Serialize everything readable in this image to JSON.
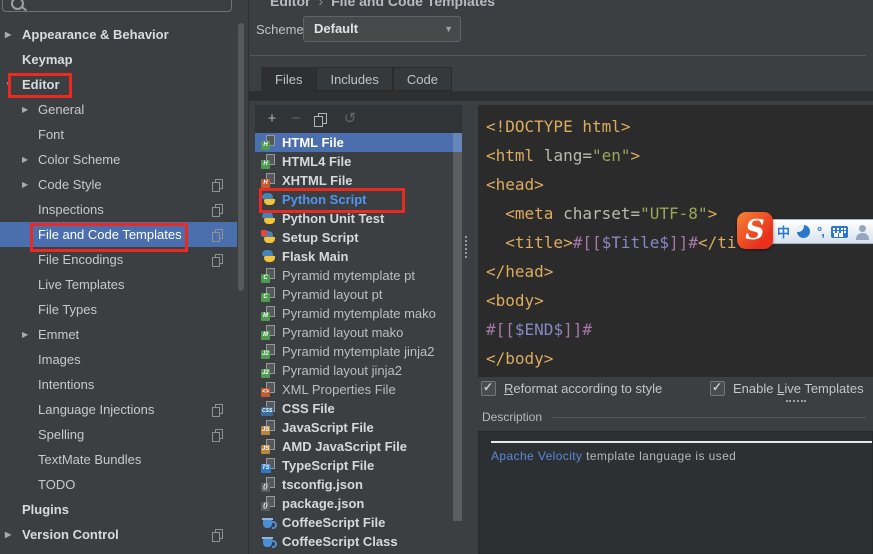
{
  "breadcrumb": {
    "section": "Editor",
    "separator": "›",
    "page": "File and Code Templates"
  },
  "search": {
    "placeholder": ""
  },
  "sidebar": {
    "items": [
      {
        "label": "Appearance & Behavior",
        "level": 1,
        "bold": true,
        "chevron": "right"
      },
      {
        "label": "Keymap",
        "level": 1,
        "bold": true
      },
      {
        "label": "Editor",
        "level": 1,
        "bold": true,
        "chevron": "down",
        "annotated": true
      },
      {
        "label": "General",
        "level": 2,
        "chevron": "right"
      },
      {
        "label": "Font",
        "level": 2
      },
      {
        "label": "Color Scheme",
        "level": 2,
        "chevron": "right"
      },
      {
        "label": "Code Style",
        "level": 2,
        "chevron": "right",
        "shareable": true
      },
      {
        "label": "Inspections",
        "level": 2,
        "shareable": true
      },
      {
        "label": "File and Code Templates",
        "level": 2,
        "selected": true,
        "shareable": true,
        "annotated": true
      },
      {
        "label": "File Encodings",
        "level": 2,
        "shareable": true
      },
      {
        "label": "Live Templates",
        "level": 2
      },
      {
        "label": "File Types",
        "level": 2
      },
      {
        "label": "Emmet",
        "level": 2,
        "chevron": "right"
      },
      {
        "label": "Images",
        "level": 2
      },
      {
        "label": "Intentions",
        "level": 2
      },
      {
        "label": "Language Injections",
        "level": 2,
        "shareable": true
      },
      {
        "label": "Spelling",
        "level": 2,
        "shareable": true
      },
      {
        "label": "TextMate Bundles",
        "level": 2
      },
      {
        "label": "TODO",
        "level": 2
      },
      {
        "label": "Plugins",
        "level": 1,
        "bold": true
      },
      {
        "label": "Version Control",
        "level": 1,
        "bold": true,
        "chevron": "right",
        "shareable": true
      }
    ]
  },
  "scheme": {
    "label": "Scheme:",
    "value": "Default"
  },
  "tabs": [
    {
      "label": "Files",
      "selected": true
    },
    {
      "label": "Includes",
      "selected": false
    },
    {
      "label": "Code",
      "selected": false
    }
  ],
  "list_toolbar": {
    "add_label": "+",
    "remove_label": "−",
    "revert_glyph": "↺"
  },
  "icon_defs": {
    "html": {
      "kind": "page-badge",
      "badge": "H",
      "bg": "#4f9b51"
    },
    "xhtml": {
      "kind": "page-badge",
      "badge": "H",
      "bg": "#c05b33"
    },
    "python": {
      "kind": "python"
    },
    "python-setup": {
      "kind": "python",
      "overlay": true
    },
    "pt": {
      "kind": "page-badge",
      "badge": "C",
      "bg": "#4f9b51"
    },
    "mako": {
      "kind": "page-badge",
      "badge": "M",
      "bg": "#4f9b51"
    },
    "jinja": {
      "kind": "page-badge",
      "badge": "J2",
      "bg": "#4f9b51"
    },
    "xml": {
      "kind": "page-badge",
      "badge": "<>",
      "bg": "#c05b33"
    },
    "css": {
      "kind": "page-badge",
      "badge": "CSS",
      "bg": "#3a6e9e"
    },
    "js": {
      "kind": "page-badge",
      "badge": "JS",
      "bg": "#b8863d"
    },
    "ts": {
      "kind": "page-badge",
      "badge": "TS",
      "bg": "#3178c6"
    },
    "json": {
      "kind": "page-badge",
      "badge": "{}",
      "bg": "#5a5e61"
    },
    "coffee": {
      "kind": "coffee"
    }
  },
  "templates": {
    "items": [
      {
        "name": "HTML File",
        "icon": "html",
        "style": "bold",
        "selected": true
      },
      {
        "name": "HTML4 File",
        "icon": "html",
        "style": "bold"
      },
      {
        "name": "XHTML File",
        "icon": "xhtml",
        "style": "bold"
      },
      {
        "name": "Python Script",
        "icon": "python",
        "style": "modblue",
        "annotated": true
      },
      {
        "name": "Python Unit Test",
        "icon": "python",
        "style": "bold"
      },
      {
        "name": "Setup Script",
        "icon": "python-setup",
        "style": "bold"
      },
      {
        "name": "Flask Main",
        "icon": "python",
        "style": "bold"
      },
      {
        "name": "Pyramid mytemplate pt",
        "icon": "pt",
        "style": "plain"
      },
      {
        "name": "Pyramid layout pt",
        "icon": "pt",
        "style": "plain"
      },
      {
        "name": "Pyramid mytemplate mako",
        "icon": "mako",
        "style": "plain"
      },
      {
        "name": "Pyramid layout mako",
        "icon": "mako",
        "style": "plain"
      },
      {
        "name": "Pyramid mytemplate jinja2",
        "icon": "jinja",
        "style": "plain"
      },
      {
        "name": "Pyramid layout jinja2",
        "icon": "jinja",
        "style": "plain"
      },
      {
        "name": "XML Properties File",
        "icon": "xml",
        "style": "plain"
      },
      {
        "name": "CSS File",
        "icon": "css",
        "style": "bold"
      },
      {
        "name": "JavaScript File",
        "icon": "js",
        "style": "bold"
      },
      {
        "name": "AMD JavaScript File",
        "icon": "js",
        "style": "bold"
      },
      {
        "name": "TypeScript File",
        "icon": "ts",
        "style": "bold"
      },
      {
        "name": "tsconfig.json",
        "icon": "json",
        "style": "bold"
      },
      {
        "name": "package.json",
        "icon": "json",
        "style": "bold"
      },
      {
        "name": "CoffeeScript File",
        "icon": "coffee",
        "style": "bold"
      },
      {
        "name": "CoffeeScript Class",
        "icon": "coffee",
        "style": "bold"
      }
    ]
  },
  "editor": {
    "lines": [
      [
        {
          "c": "tag",
          "t": "<!DOCTYPE html>"
        }
      ],
      [
        {
          "c": "tag",
          "t": "<html"
        },
        {
          "c": "attr",
          "t": " lang="
        },
        {
          "c": "val",
          "t": "\"en\""
        },
        {
          "c": "tag",
          "t": ">"
        }
      ],
      [
        {
          "c": "tag",
          "t": "<head>"
        }
      ],
      [
        {
          "c": "pl",
          "t": "  "
        },
        {
          "c": "tag",
          "t": "<meta"
        },
        {
          "c": "attr",
          "t": " charset="
        },
        {
          "c": "val",
          "t": "\"UTF-8\""
        },
        {
          "c": "tag",
          "t": ">"
        }
      ],
      [
        {
          "c": "pl",
          "t": "  "
        },
        {
          "c": "tag",
          "t": "<title>"
        },
        {
          "c": "tpl",
          "t": "#[["
        },
        {
          "c": "var",
          "t": "$Title$"
        },
        {
          "c": "tpl",
          "t": "]]#"
        },
        {
          "c": "tag",
          "t": "</title>"
        }
      ],
      [
        {
          "c": "tag",
          "t": "</head>"
        }
      ],
      [
        {
          "c": "tag",
          "t": "<body>"
        }
      ],
      [
        {
          "c": "tpl",
          "t": "#[["
        },
        {
          "c": "var",
          "t": "$END$"
        },
        {
          "c": "tpl",
          "t": "]]#"
        }
      ],
      [
        {
          "c": "tag",
          "t": "</body>"
        }
      ]
    ]
  },
  "options": {
    "reformat": {
      "pre": "",
      "key": "R",
      "rest": "eformat according to style",
      "checked": true
    },
    "live_templates": {
      "pre": "Enable ",
      "key": "L",
      "rest": "ive Templates",
      "checked": true
    }
  },
  "description": {
    "label": "Description",
    "link_text": "Apache Velocity",
    "text": " template language is used"
  },
  "ime": {
    "chinese_mode": "中",
    "punct_mode": "°,",
    "logo_letter": "S"
  },
  "colors": {
    "selection": "#4b6eaf",
    "modified_template": "#5394ec",
    "annotation": "#ea2a20",
    "editor_bg": "#2b2b2b",
    "panel_bg": "#3c3f41"
  }
}
